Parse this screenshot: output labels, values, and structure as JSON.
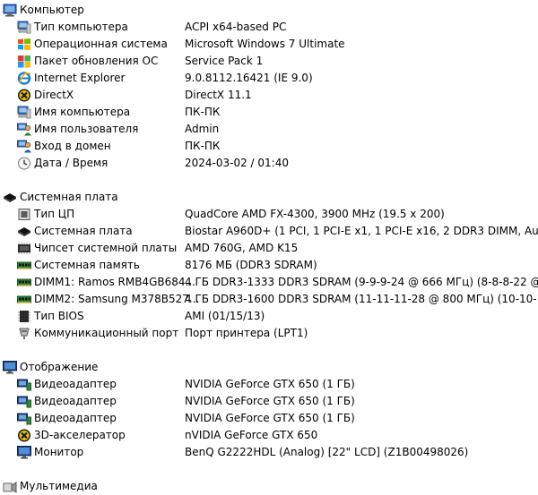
{
  "sections": [
    {
      "title": "Компьютер",
      "icon": "computer-icon",
      "items": [
        {
          "label": "Тип компьютера",
          "value": "ACPI x64-based PC",
          "icon": "computer-type-icon"
        },
        {
          "label": "Операционная система",
          "value": "Microsoft Windows 7 Ultimate",
          "icon": "windows-logo-icon"
        },
        {
          "label": "Пакет обновления ОС",
          "value": "Service Pack 1",
          "icon": "service-pack-icon"
        },
        {
          "label": "Internet Explorer",
          "value": "9.0.8112.16421 (IE 9.0)",
          "icon": "internet-explorer-icon"
        },
        {
          "label": "DirectX",
          "value": "DirectX 11.1",
          "icon": "directx-icon"
        },
        {
          "label": "Имя компьютера",
          "value": "ПК-ПК",
          "icon": "computer-name-icon"
        },
        {
          "label": "Имя пользователя",
          "value": "Admin",
          "icon": "user-icon"
        },
        {
          "label": "Вход в домен",
          "value": "ПК-ПК",
          "icon": "domain-login-icon"
        },
        {
          "label": "Дата / Время",
          "value": "2024-03-02 / 01:40",
          "icon": "clock-icon"
        }
      ]
    },
    {
      "title": "Системная плата",
      "icon": "motherboard-icon",
      "items": [
        {
          "label": "Тип ЦП",
          "value": "QuadCore AMD FX-4300, 3900 MHz (19.5 x 200)",
          "icon": "cpu-icon"
        },
        {
          "label": "Системная плата",
          "value": "Biostar A960D+  (1 PCI, 1 PCI-E x1, 1 PCI-E x16, 2 DDR3 DIMM, Audi...",
          "icon": "motherboard-icon"
        },
        {
          "label": "Чипсет системной платы",
          "value": "AMD 760G, AMD K15",
          "icon": "chipset-icon"
        },
        {
          "label": "Системная память",
          "value": "8176 МБ  (DDR3 SDRAM)",
          "icon": "memory-icon"
        },
        {
          "label": "DIMM1: Ramos RMB4GB684...",
          "value": "4 ГБ DDR3-1333 DDR3 SDRAM  (9-9-9-24 @ 666 МГц)  (8-8-8-22 @ ...",
          "icon": "memory-module-icon"
        },
        {
          "label": "DIMM2: Samsung M378B527...",
          "value": "4 ГБ DDR3-1600 DDR3 SDRAM  (11-11-11-28 @ 800 МГц)  (10-10-1...",
          "icon": "memory-module-icon"
        },
        {
          "label": "Тип BIOS",
          "value": "AMI (01/15/13)",
          "icon": "bios-icon"
        },
        {
          "label": "Коммуникационный порт",
          "value": "Порт принтера (LPT1)",
          "icon": "port-icon"
        }
      ]
    },
    {
      "title": "Отображение",
      "icon": "display-icon",
      "items": [
        {
          "label": "Видеоадаптер",
          "value": "NVIDIA GeForce GTX 650  (1 ГБ)",
          "icon": "video-adapter-icon"
        },
        {
          "label": "Видеоадаптер",
          "value": "NVIDIA GeForce GTX 650  (1 ГБ)",
          "icon": "video-adapter-icon"
        },
        {
          "label": "Видеоадаптер",
          "value": "NVIDIA GeForce GTX 650  (1 ГБ)",
          "icon": "video-adapter-icon"
        },
        {
          "label": "3D-акселератор",
          "value": "nVIDIA GeForce GTX 650",
          "icon": "directx-icon"
        },
        {
          "label": "Монитор",
          "value": "BenQ G2222HDL (Analog)  [22\" LCD]  (Z1B00498026)",
          "icon": "monitor-icon"
        }
      ]
    },
    {
      "title": "Мультимедиа",
      "icon": "multimedia-icon",
      "items": []
    }
  ]
}
